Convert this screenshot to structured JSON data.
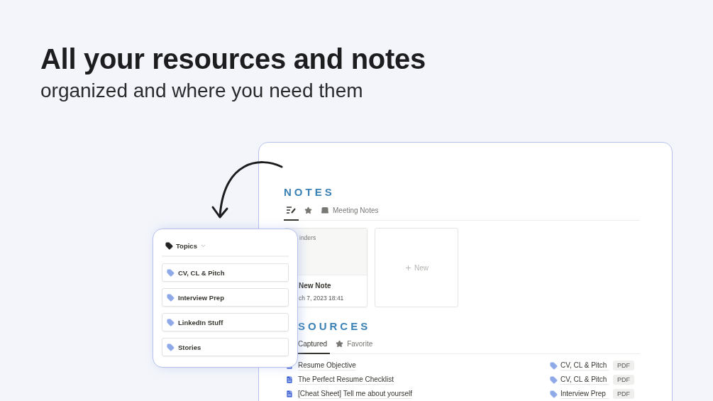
{
  "headline": "All your resources and notes",
  "subheadline": "organized and where you need them",
  "notes": {
    "title": "NOTES",
    "tabs": [
      {
        "kind": "list-edit",
        "selected": true
      },
      {
        "kind": "star",
        "selected": false
      },
      {
        "kind": "laptop",
        "label": "Meeting Notes",
        "selected": false
      }
    ],
    "cards": [
      {
        "kind": "note",
        "cover_label": "inders",
        "title": "New Note",
        "date": "ch 7, 2023 18:41"
      },
      {
        "kind": "new",
        "label": "New"
      }
    ]
  },
  "resources": {
    "title": "SOURCES",
    "tabs": [
      {
        "kind": "plain",
        "label": "Captured",
        "selected": true
      },
      {
        "kind": "star",
        "label": "Favorite",
        "selected": false
      }
    ],
    "rows": [
      {
        "title": "Resume Objective",
        "topic": "CV, CL & Pitch",
        "format": "PDF"
      },
      {
        "title": "The Perfect Resume Checklist",
        "topic": "CV, CL & Pitch",
        "format": "PDF"
      },
      {
        "title": "[Cheat Sheet] Tell me about yourself",
        "topic": "Interview Prep",
        "format": "PDF"
      }
    ]
  },
  "topics_popover": {
    "title": "Topics",
    "items": [
      {
        "label": "CV, CL & Pitch"
      },
      {
        "label": "Interview Prep"
      },
      {
        "label": "LinkedIn Stuff"
      },
      {
        "label": "Stories"
      }
    ]
  }
}
